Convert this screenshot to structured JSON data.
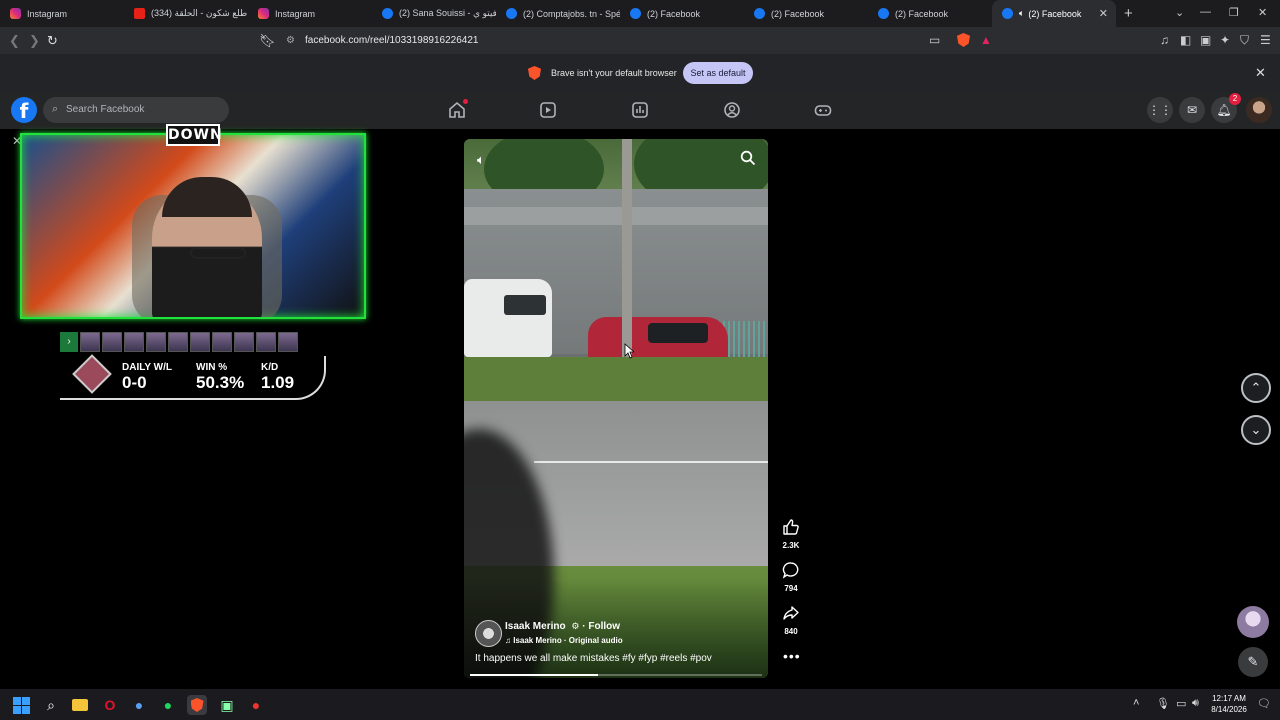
{
  "browser": {
    "tabs": [
      {
        "label": "Instagram",
        "icon": "instagram-icon",
        "kind": "ig"
      },
      {
        "label": "(334) طلع شكون - الحلقة",
        "icon": "youtube-icon",
        "kind": "yt"
      },
      {
        "label": "Instagram",
        "icon": "instagram-icon",
        "kind": "ig"
      },
      {
        "label": "(2) Sana Souissi - دفيتو ي",
        "icon": "facebook-icon",
        "kind": "fb"
      },
      {
        "label": "(2) Comptajobs. tn - Spéc",
        "icon": "facebook-icon",
        "kind": "fb"
      },
      {
        "label": "(2) Facebook",
        "icon": "facebook-icon",
        "kind": "fb"
      },
      {
        "label": "(2) Facebook",
        "icon": "facebook-icon",
        "kind": "fb"
      },
      {
        "label": "(2) Facebook",
        "icon": "facebook-icon",
        "kind": "fb"
      },
      {
        "label": "(2) Facebook",
        "icon": "facebook-icon",
        "kind": "fb",
        "active": true
      }
    ],
    "url": "facebook.com/reel/1033198916226421",
    "infobar": {
      "message": "Brave isn't your default browser",
      "button": "Set as default"
    }
  },
  "facebook": {
    "search_placeholder": "Search Facebook",
    "notification_count": "2",
    "nav_icons": [
      "home-icon",
      "reels-icon",
      "feeds-icon",
      "groups-icon",
      "gaming-icon"
    ]
  },
  "stream_overlay": {
    "logo": "DOWN",
    "stats": [
      {
        "label": "DAILY W/L",
        "value": "0-0"
      },
      {
        "label": "WIN %",
        "value": "50.3%"
      },
      {
        "label": "K/D",
        "value": "1.09"
      }
    ]
  },
  "reel": {
    "author": "Isaak Merino",
    "follow": "Follow",
    "audio": "Isaak Merino · Original audio",
    "caption": "It happens we all make mistakes #fy #fyp #reels #pov",
    "progress": 0.44,
    "likes": "2.3K",
    "comments": "794",
    "shares": "840"
  },
  "taskbar": {
    "time": "12:17 AM",
    "date": "8/14/2026"
  },
  "colors": {
    "facebook_blue": "#1877f2",
    "notification_red": "#e41e3f",
    "overlay_green": "#21e23b"
  }
}
